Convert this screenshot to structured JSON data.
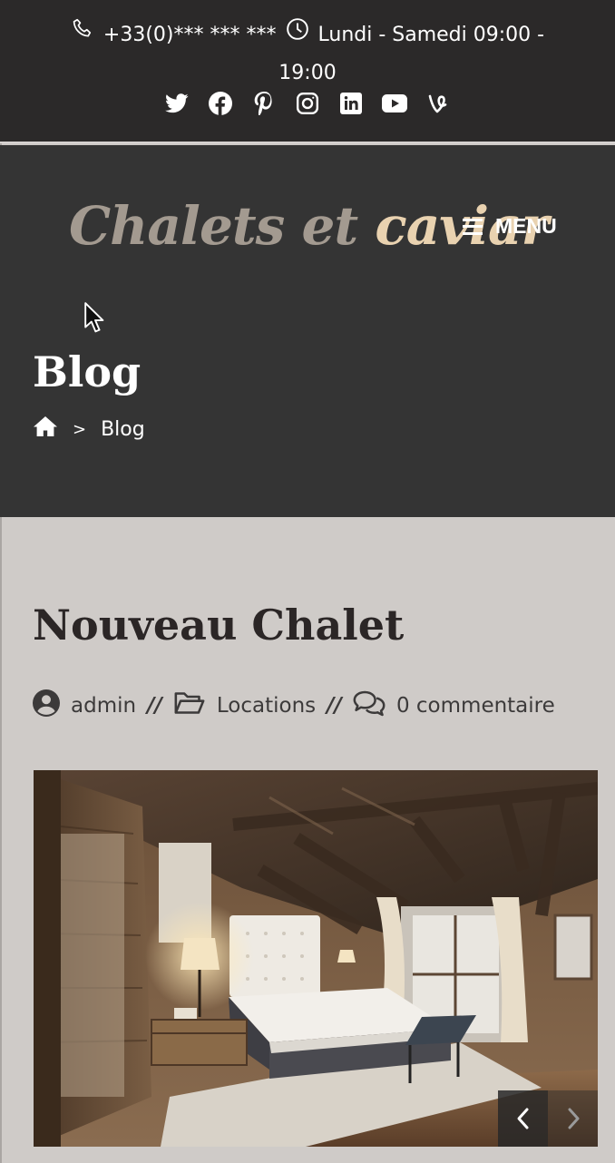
{
  "topbar": {
    "phone": "+33(0)*** *** ***",
    "hours": "Lundi - Samedi 09:00 - 19:00",
    "icons": [
      "phone-icon",
      "clock-icon"
    ]
  },
  "socials": [
    "twitter-icon",
    "facebook-icon",
    "pinterest-icon",
    "instagram-icon",
    "linkedin-icon",
    "youtube-icon",
    "vine-icon"
  ],
  "header": {
    "logo_part1": "Chalets et",
    "logo_part2": "caviar",
    "menu_label": "MENU"
  },
  "page": {
    "title": "Blog",
    "breadcrumb": {
      "separator": ">",
      "current": "Blog"
    }
  },
  "post": {
    "title": "Nouveau Chalet",
    "author": "admin",
    "category": "Locations",
    "comments": "0 commentaire",
    "meta_separator": "//"
  },
  "colors": {
    "topbar_bg": "#2b2929",
    "header_bg": "#343434",
    "content_bg": "#cfcbc8",
    "logo_muted": "#a39a90",
    "logo_accent": "#e9d2b0"
  }
}
